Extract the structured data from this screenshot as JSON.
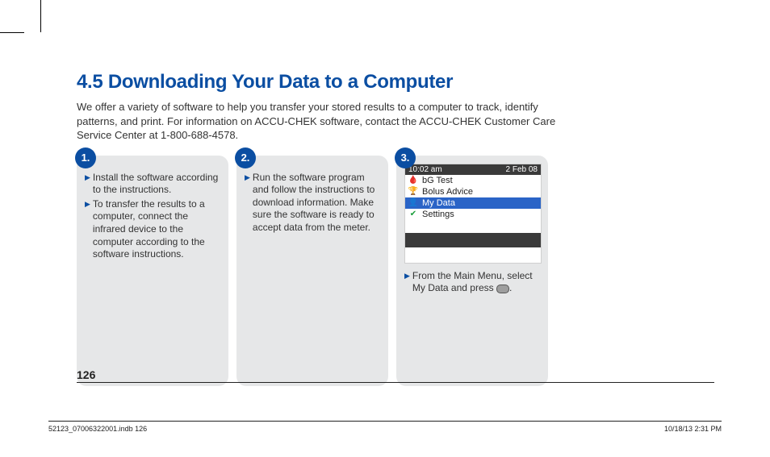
{
  "heading": "4.5 Downloading Your Data to a Computer",
  "intro": "We offer a variety of software to help you transfer your stored results to a computer to track, identify patterns, and print. For information on ACCU-CHEK software, contact the ACCU-CHEK Customer Care Service Center at 1-800-688-4578.",
  "steps": {
    "s1": {
      "num": "1.",
      "b1": "Install the software according to the instructions.",
      "b2": "To transfer the results to a computer, connect the infrared device to the computer according to the software instructions."
    },
    "s2": {
      "num": "2.",
      "b1": "Run the software program and follow the instructions to download information. Make sure the software is ready to accept data from the meter."
    },
    "s3": {
      "num": "3.",
      "screen": {
        "time": "10:02 am",
        "date": "2 Feb 08",
        "r1": "bG Test",
        "r2": "Bolus Advice",
        "r3": "My Data",
        "r4": "Settings"
      },
      "b1a": "From the Main Menu, select My Data and press ",
      "b1b": "."
    }
  },
  "page_number": "126",
  "footer": {
    "left": "52123_07006322001.indb   126",
    "right": "10/18/13   2:31 PM"
  }
}
